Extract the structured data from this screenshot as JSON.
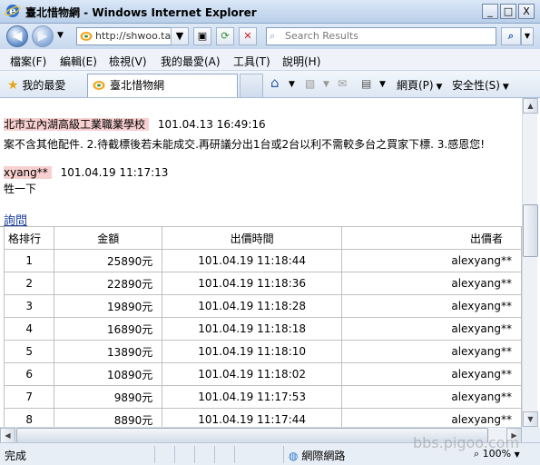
{
  "window": {
    "title": "臺北惜物網 - Windows Internet Explorer",
    "minimize": "_",
    "maximize": "□",
    "close": "X"
  },
  "address": {
    "url": "http://shwoo.tai...",
    "search_placeholder": "Search Results"
  },
  "menu": [
    "檔案(F)",
    "編輯(E)",
    "檢視(V)",
    "我的最愛(A)",
    "工具(T)",
    "說明(H)"
  ],
  "favorites": {
    "label": "我的最愛",
    "tab_title": "臺北惜物網",
    "page_label": "網頁(P)",
    "safety_label": "安全性(S)"
  },
  "content": {
    "seller_name": "北市立內湖高級工業職業學校",
    "seller_time": "101.04.13 16:49:16",
    "seller_message": "案不含其他配件. 2.待截標後若未能成交.再研議分出1台或2台以利不需較多台之買家下標. 3.感恩您!",
    "buyer_name": "xyang**",
    "buyer_time": "101.04.19 11:17:13",
    "buyer_message": "牲一下",
    "section_link": "詢問"
  },
  "bids": {
    "headers": [
      "格排行",
      "金額",
      "出價時間",
      "出價者"
    ],
    "rows": [
      {
        "rank": "1",
        "amount": "25890元",
        "time": "101.04.19 11:18:44",
        "bidder": "alexyang**"
      },
      {
        "rank": "2",
        "amount": "22890元",
        "time": "101.04.19 11:18:36",
        "bidder": "alexyang**"
      },
      {
        "rank": "3",
        "amount": "19890元",
        "time": "101.04.19 11:18:28",
        "bidder": "alexyang**"
      },
      {
        "rank": "4",
        "amount": "16890元",
        "time": "101.04.19 11:18:18",
        "bidder": "alexyang**"
      },
      {
        "rank": "5",
        "amount": "13890元",
        "time": "101.04.19 11:18:10",
        "bidder": "alexyang**"
      },
      {
        "rank": "6",
        "amount": "10890元",
        "time": "101.04.19 11:18:02",
        "bidder": "alexyang**"
      },
      {
        "rank": "7",
        "amount": "9890元",
        "time": "101.04.19 11:17:53",
        "bidder": "alexyang**"
      },
      {
        "rank": "8",
        "amount": "8890元",
        "time": "101.04.19 11:17:44",
        "bidder": "alexyang**"
      }
    ]
  },
  "status": {
    "text": "完成",
    "zone": "網際網路",
    "zoom": "100%",
    "watermark": "bbs.pigoo.com"
  },
  "icons": {
    "ie": "ie-logo-icon",
    "back": "back-arrow-icon",
    "forward": "forward-arrow-icon",
    "refresh": "refresh-icon",
    "stop": "stop-icon",
    "search": "search-icon",
    "star": "favorites-star-icon",
    "home": "home-icon",
    "feed": "rss-feed-icon",
    "mail": "mail-icon",
    "print": "printer-icon",
    "globe": "globe-icon"
  }
}
